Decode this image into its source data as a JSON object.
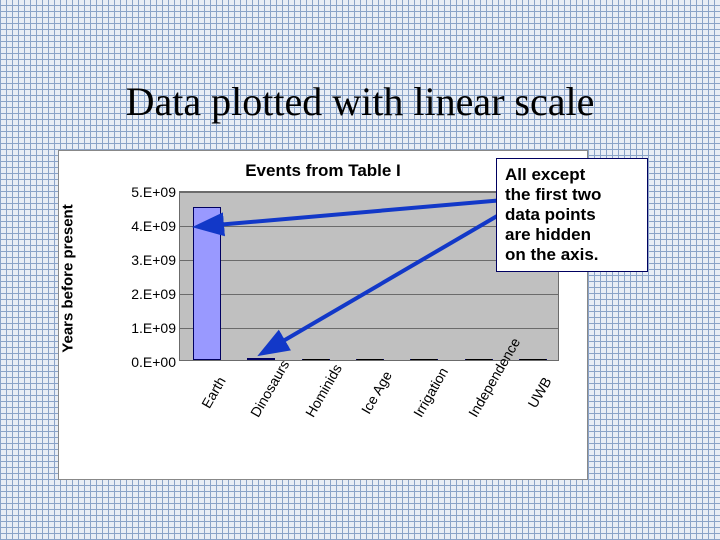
{
  "slide_title": "Data plotted with linear scale",
  "annotation": {
    "line1": "All except",
    "line2": "the first two",
    "line3": "data points",
    "line4": "are hidden",
    "line5": "on the axis."
  },
  "chart_data": {
    "type": "bar",
    "title": "Events from Table I",
    "ylabel": "Years before present",
    "xlabel": "",
    "categories": [
      "Earth",
      "Dinosaurs",
      "Hominids",
      "Ice Age",
      "Irrigation",
      "Independence",
      "UWB"
    ],
    "values": [
      4500000000,
      65000000,
      2000000,
      10000,
      6000,
      230,
      15
    ],
    "ylim": [
      0,
      5000000000
    ],
    "ytick_labels": [
      "0.E+00",
      "1.E+09",
      "2.E+09",
      "3.E+09",
      "4.E+09",
      "5.E+09"
    ],
    "ytick_values": [
      0,
      1000000000,
      2000000000,
      3000000000,
      4000000000,
      5000000000
    ]
  }
}
